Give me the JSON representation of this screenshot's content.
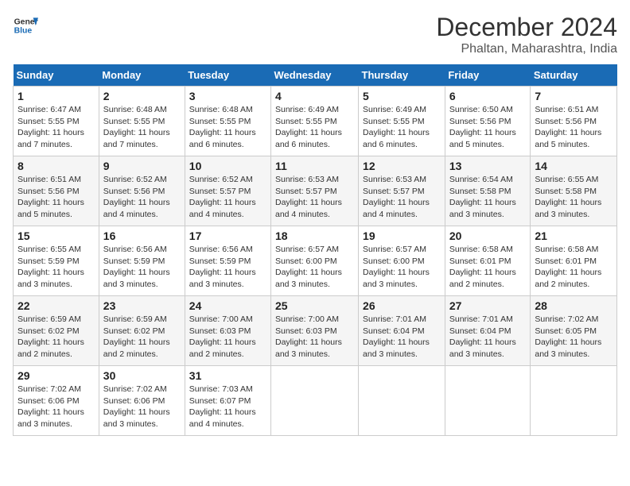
{
  "logo": {
    "line1": "General",
    "line2": "Blue"
  },
  "title": "December 2024",
  "location": "Phaltan, Maharashtra, India",
  "days_of_week": [
    "Sunday",
    "Monday",
    "Tuesday",
    "Wednesday",
    "Thursday",
    "Friday",
    "Saturday"
  ],
  "weeks": [
    [
      {
        "day": 1,
        "sunrise": "6:47 AM",
        "sunset": "5:55 PM",
        "daylight": "11 hours and 7 minutes."
      },
      {
        "day": 2,
        "sunrise": "6:48 AM",
        "sunset": "5:55 PM",
        "daylight": "11 hours and 7 minutes."
      },
      {
        "day": 3,
        "sunrise": "6:48 AM",
        "sunset": "5:55 PM",
        "daylight": "11 hours and 6 minutes."
      },
      {
        "day": 4,
        "sunrise": "6:49 AM",
        "sunset": "5:55 PM",
        "daylight": "11 hours and 6 minutes."
      },
      {
        "day": 5,
        "sunrise": "6:49 AM",
        "sunset": "5:55 PM",
        "daylight": "11 hours and 6 minutes."
      },
      {
        "day": 6,
        "sunrise": "6:50 AM",
        "sunset": "5:56 PM",
        "daylight": "11 hours and 5 minutes."
      },
      {
        "day": 7,
        "sunrise": "6:51 AM",
        "sunset": "5:56 PM",
        "daylight": "11 hours and 5 minutes."
      }
    ],
    [
      {
        "day": 8,
        "sunrise": "6:51 AM",
        "sunset": "5:56 PM",
        "daylight": "11 hours and 5 minutes."
      },
      {
        "day": 9,
        "sunrise": "6:52 AM",
        "sunset": "5:56 PM",
        "daylight": "11 hours and 4 minutes."
      },
      {
        "day": 10,
        "sunrise": "6:52 AM",
        "sunset": "5:57 PM",
        "daylight": "11 hours and 4 minutes."
      },
      {
        "day": 11,
        "sunrise": "6:53 AM",
        "sunset": "5:57 PM",
        "daylight": "11 hours and 4 minutes."
      },
      {
        "day": 12,
        "sunrise": "6:53 AM",
        "sunset": "5:57 PM",
        "daylight": "11 hours and 4 minutes."
      },
      {
        "day": 13,
        "sunrise": "6:54 AM",
        "sunset": "5:58 PM",
        "daylight": "11 hours and 3 minutes."
      },
      {
        "day": 14,
        "sunrise": "6:55 AM",
        "sunset": "5:58 PM",
        "daylight": "11 hours and 3 minutes."
      }
    ],
    [
      {
        "day": 15,
        "sunrise": "6:55 AM",
        "sunset": "5:59 PM",
        "daylight": "11 hours and 3 minutes."
      },
      {
        "day": 16,
        "sunrise": "6:56 AM",
        "sunset": "5:59 PM",
        "daylight": "11 hours and 3 minutes."
      },
      {
        "day": 17,
        "sunrise": "6:56 AM",
        "sunset": "5:59 PM",
        "daylight": "11 hours and 3 minutes."
      },
      {
        "day": 18,
        "sunrise": "6:57 AM",
        "sunset": "6:00 PM",
        "daylight": "11 hours and 3 minutes."
      },
      {
        "day": 19,
        "sunrise": "6:57 AM",
        "sunset": "6:00 PM",
        "daylight": "11 hours and 3 minutes."
      },
      {
        "day": 20,
        "sunrise": "6:58 AM",
        "sunset": "6:01 PM",
        "daylight": "11 hours and 2 minutes."
      },
      {
        "day": 21,
        "sunrise": "6:58 AM",
        "sunset": "6:01 PM",
        "daylight": "11 hours and 2 minutes."
      }
    ],
    [
      {
        "day": 22,
        "sunrise": "6:59 AM",
        "sunset": "6:02 PM",
        "daylight": "11 hours and 2 minutes."
      },
      {
        "day": 23,
        "sunrise": "6:59 AM",
        "sunset": "6:02 PM",
        "daylight": "11 hours and 2 minutes."
      },
      {
        "day": 24,
        "sunrise": "7:00 AM",
        "sunset": "6:03 PM",
        "daylight": "11 hours and 2 minutes."
      },
      {
        "day": 25,
        "sunrise": "7:00 AM",
        "sunset": "6:03 PM",
        "daylight": "11 hours and 3 minutes."
      },
      {
        "day": 26,
        "sunrise": "7:01 AM",
        "sunset": "6:04 PM",
        "daylight": "11 hours and 3 minutes."
      },
      {
        "day": 27,
        "sunrise": "7:01 AM",
        "sunset": "6:04 PM",
        "daylight": "11 hours and 3 minutes."
      },
      {
        "day": 28,
        "sunrise": "7:02 AM",
        "sunset": "6:05 PM",
        "daylight": "11 hours and 3 minutes."
      }
    ],
    [
      {
        "day": 29,
        "sunrise": "7:02 AM",
        "sunset": "6:06 PM",
        "daylight": "11 hours and 3 minutes."
      },
      {
        "day": 30,
        "sunrise": "7:02 AM",
        "sunset": "6:06 PM",
        "daylight": "11 hours and 3 minutes."
      },
      {
        "day": 31,
        "sunrise": "7:03 AM",
        "sunset": "6:07 PM",
        "daylight": "11 hours and 4 minutes."
      },
      null,
      null,
      null,
      null
    ]
  ]
}
